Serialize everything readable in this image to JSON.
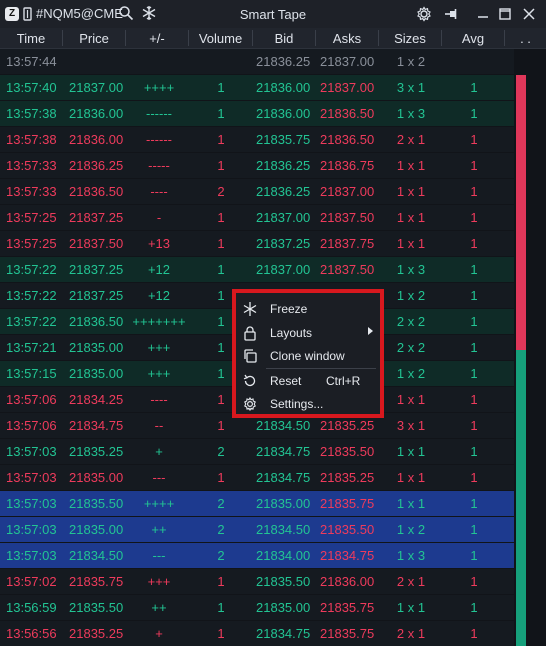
{
  "titlebar": {
    "logo": "Z",
    "symbol": "#NQM5@CME",
    "title": "Smart Tape"
  },
  "columns": {
    "time": "Time",
    "price": "Price",
    "diff": "+/-",
    "volume": "Volume",
    "bid": "Bid",
    "asks": "Asks",
    "sizes": "Sizes",
    "avg": "Avg",
    "more": ". ."
  },
  "colors": {
    "buy_text": "#22c493",
    "sell_text": "#ee3b5c",
    "neutral_text": "#8a909a",
    "buy_row": "#0f2b27",
    "sell_row": "#151a20",
    "highlight_row": "#1d3a8f",
    "accent_red": "#d8181e"
  },
  "rows": [
    {
      "time": "13:57:44",
      "price": "",
      "diff": "",
      "volume": "",
      "bid": "21836.25",
      "ask": "21837.00",
      "sizes": "1 x 2",
      "avg": "",
      "side": "neutral"
    },
    {
      "time": "13:57:40",
      "price": "21837.00",
      "diff": "++++",
      "volume": "1",
      "bid": "21836.00",
      "ask": "21837.00",
      "sizes": "3 x 1",
      "avg": "1",
      "side": "buy"
    },
    {
      "time": "13:57:38",
      "price": "21836.00",
      "diff": "------",
      "volume": "1",
      "bid": "21836.00",
      "ask": "21836.50",
      "sizes": "1 x 3",
      "avg": "1",
      "side": "buy"
    },
    {
      "time": "13:57:38",
      "price": "21836.00",
      "diff": "------",
      "volume": "1",
      "bid": "21835.75",
      "ask": "21836.50",
      "sizes": "2 x 1",
      "avg": "1",
      "side": "sell"
    },
    {
      "time": "13:57:33",
      "price": "21836.25",
      "diff": "-----",
      "volume": "1",
      "bid": "21836.25",
      "ask": "21836.75",
      "sizes": "1 x 1",
      "avg": "1",
      "side": "sell"
    },
    {
      "time": "13:57:33",
      "price": "21836.50",
      "diff": "----",
      "volume": "2",
      "bid": "21836.25",
      "ask": "21837.00",
      "sizes": "1 x 1",
      "avg": "1",
      "side": "sell"
    },
    {
      "time": "13:57:25",
      "price": "21837.25",
      "diff": "-",
      "volume": "1",
      "bid": "21837.00",
      "ask": "21837.50",
      "sizes": "1 x 1",
      "avg": "1",
      "side": "sell"
    },
    {
      "time": "13:57:25",
      "price": "21837.50",
      "diff": "+13",
      "volume": "1",
      "bid": "21837.25",
      "ask": "21837.75",
      "sizes": "1 x 1",
      "avg": "1",
      "side": "sell"
    },
    {
      "time": "13:57:22",
      "price": "21837.25",
      "diff": "+12",
      "volume": "1",
      "bid": "21837.00",
      "ask": "21837.50",
      "sizes": "1 x 3",
      "avg": "1",
      "side": "buy"
    },
    {
      "time": "13:57:22",
      "price": "21837.25",
      "diff": "+12",
      "volume": "1",
      "bid": "",
      "ask": "",
      "sizes": "1 x 2",
      "avg": "1",
      "side": "buy-plain"
    },
    {
      "time": "13:57:22",
      "price": "21836.50",
      "diff": "+++++++",
      "volume": "1",
      "bid": "",
      "ask": "",
      "sizes": "2 x 2",
      "avg": "1",
      "side": "buy"
    },
    {
      "time": "13:57:21",
      "price": "21835.00",
      "diff": "+++",
      "volume": "1",
      "bid": "",
      "ask": "",
      "sizes": "2 x 2",
      "avg": "1",
      "side": "buy-plain"
    },
    {
      "time": "13:57:15",
      "price": "21835.00",
      "diff": "+++",
      "volume": "1",
      "bid": "",
      "ask": "",
      "sizes": "1 x 2",
      "avg": "1",
      "side": "buy"
    },
    {
      "time": "13:57:06",
      "price": "21834.25",
      "diff": "----",
      "volume": "1",
      "bid": "",
      "ask": "",
      "sizes": "1 x 1",
      "avg": "1",
      "side": "sell"
    },
    {
      "time": "13:57:06",
      "price": "21834.75",
      "diff": "--",
      "volume": "1",
      "bid": "21834.50",
      "ask": "21835.25",
      "sizes": "3 x 1",
      "avg": "1",
      "side": "sell"
    },
    {
      "time": "13:57:03",
      "price": "21835.25",
      "diff": "+",
      "volume": "2",
      "bid": "21834.75",
      "ask": "21835.50",
      "sizes": "1 x 1",
      "avg": "1",
      "side": "buy-plain"
    },
    {
      "time": "13:57:03",
      "price": "21835.00",
      "diff": "---",
      "volume": "1",
      "bid": "21834.75",
      "ask": "21835.25",
      "sizes": "1 x 1",
      "avg": "1",
      "side": "sell"
    },
    {
      "time": "13:57:03",
      "price": "21835.50",
      "diff": "++++",
      "volume": "2",
      "bid": "21835.00",
      "ask": "21835.75",
      "sizes": "1 x 1",
      "avg": "1",
      "side": "highlight"
    },
    {
      "time": "13:57:03",
      "price": "21835.00",
      "diff": "++",
      "volume": "2",
      "bid": "21834.50",
      "ask": "21835.50",
      "sizes": "1 x 2",
      "avg": "1",
      "side": "highlight"
    },
    {
      "time": "13:57:03",
      "price": "21834.50",
      "diff": "---",
      "volume": "2",
      "bid": "21834.00",
      "ask": "21834.75",
      "sizes": "1 x 3",
      "avg": "1",
      "side": "highlight"
    },
    {
      "time": "13:57:02",
      "price": "21835.75",
      "diff": "+++",
      "volume": "1",
      "bid": "21835.50",
      "ask": "21836.00",
      "sizes": "2 x 1",
      "avg": "1",
      "side": "sell"
    },
    {
      "time": "13:56:59",
      "price": "21835.50",
      "diff": "++",
      "volume": "1",
      "bid": "21835.00",
      "ask": "21835.75",
      "sizes": "1 x 1",
      "avg": "1",
      "side": "buy-plain"
    },
    {
      "time": "13:56:56",
      "price": "21835.25",
      "diff": "+",
      "volume": "1",
      "bid": "21834.75",
      "ask": "21835.75",
      "sizes": "2 x 1",
      "avg": "1",
      "side": "sell"
    }
  ],
  "context_menu": {
    "items": [
      {
        "label": "Freeze",
        "shortcut": "",
        "icon": "snowflake-icon",
        "submenu": false
      },
      {
        "label": "Layouts",
        "shortcut": "",
        "icon": "lock-icon",
        "submenu": true
      },
      {
        "label": "Clone window",
        "shortcut": "",
        "icon": "clone-icon",
        "submenu": false
      },
      {
        "label": "Reset",
        "shortcut": "Ctrl+R",
        "icon": "reset-icon",
        "submenu": false
      },
      {
        "label": "Settings...",
        "shortcut": "",
        "icon": "gear-icon",
        "submenu": false
      }
    ]
  }
}
